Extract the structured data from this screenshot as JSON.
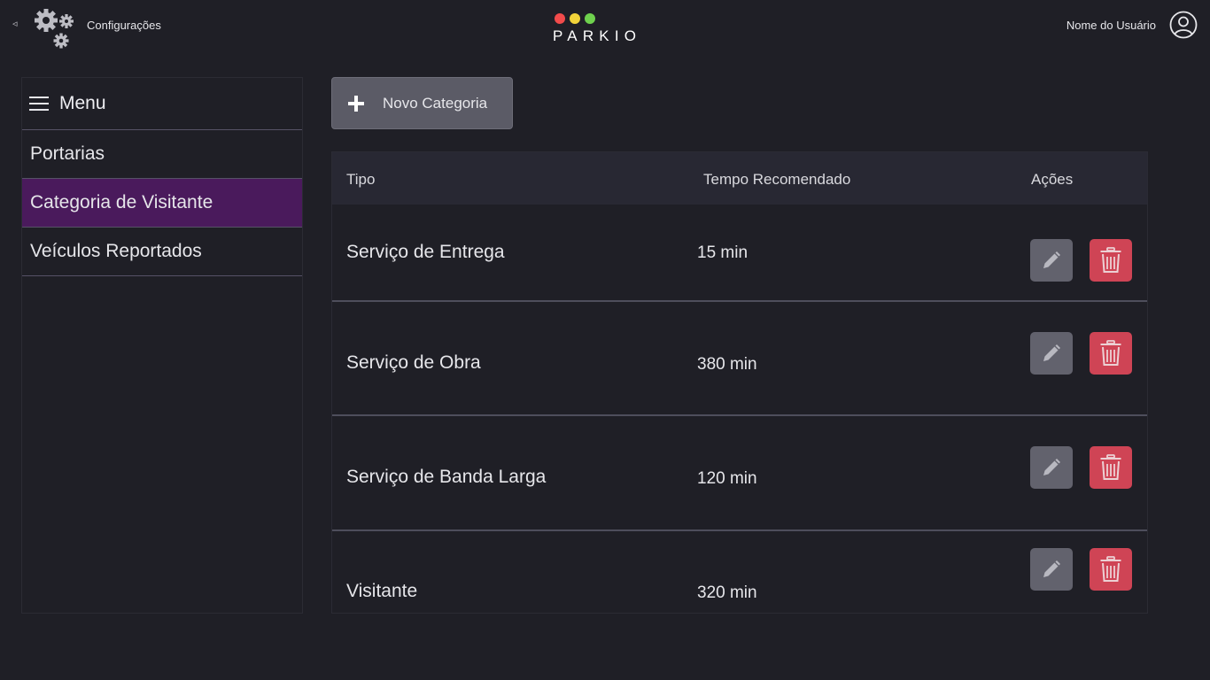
{
  "header": {
    "back_glyph": "◃",
    "settings_label": "Configurações",
    "logo_text": "PARKIO",
    "logo_dots": [
      "#f24b4b",
      "#f2d33a",
      "#6fd14e"
    ],
    "user_name": "Nome do Usuário"
  },
  "sidebar": {
    "menu_title": "Menu",
    "items": [
      {
        "label": "Portarias",
        "active": false
      },
      {
        "label": "Categoria de Visitante",
        "active": true
      },
      {
        "label": "Veículos Reportados",
        "active": false
      }
    ]
  },
  "toolbar": {
    "add_label": "Novo Categoria"
  },
  "table": {
    "headers": [
      "Tipo",
      "Tempo Recomendado",
      "Ações"
    ],
    "rows": [
      {
        "tipo": "Serviço de Entrega",
        "tempo": "15 min"
      },
      {
        "tipo": "Serviço de Obra",
        "tempo": "380 min"
      },
      {
        "tipo": "Serviço de Banda Larga",
        "tempo": "120 min"
      },
      {
        "tipo": "Visitante",
        "tempo": "320 min"
      }
    ]
  },
  "colors": {
    "background": "#1f1f26",
    "active_item": "#4a1a5c",
    "edit_button": "#62626d",
    "delete_button": "#cf4455"
  }
}
